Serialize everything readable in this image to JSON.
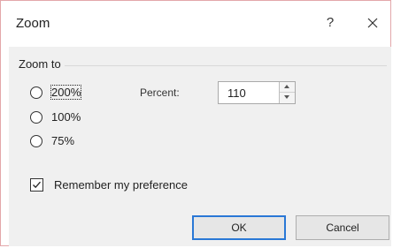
{
  "dialog": {
    "title": "Zoom",
    "help_label": "?",
    "close_label": "×"
  },
  "zoom_group": {
    "label": "Zoom to",
    "options": [
      {
        "label": "200%",
        "selected": false
      },
      {
        "label": "100%",
        "selected": false
      },
      {
        "label": "75%",
        "selected": false
      }
    ]
  },
  "percent": {
    "label": "Percent:",
    "value": "110"
  },
  "remember": {
    "label": "Remember my preference",
    "checked": true
  },
  "buttons": {
    "ok_label": "OK",
    "cancel_label": "Cancel"
  },
  "colors": {
    "default_button_border": "#2a78d6",
    "dialog_border": "#e3a7aa",
    "panel_background": "#f0f0f0"
  }
}
